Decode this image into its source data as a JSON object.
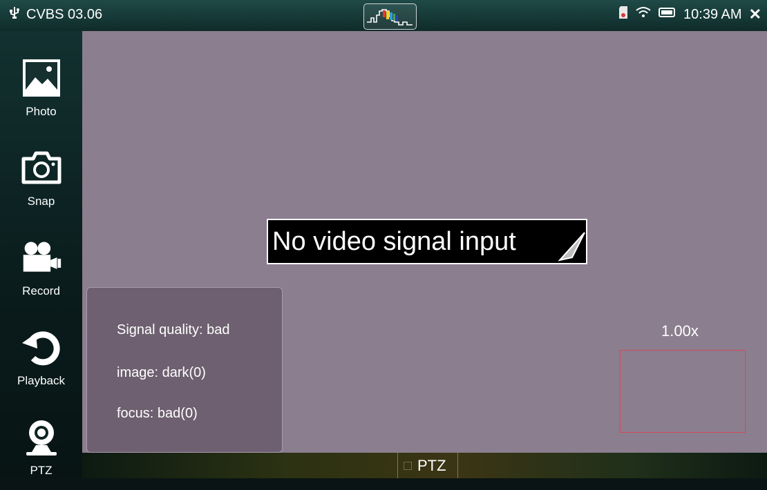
{
  "status": {
    "channel": "CVBS 03.06",
    "time": "10:39 AM",
    "close_glyph": "✕",
    "signal_icon": "usb-icon",
    "center_icon": "waveform-icon",
    "sd_icon": "sd-card-icon",
    "wifi_icon": "wifi-icon",
    "battery_icon": "battery-icon"
  },
  "sidebar": {
    "items": [
      {
        "label": "Photo",
        "icon": "photo-icon"
      },
      {
        "label": "Snap",
        "icon": "camera-icon"
      },
      {
        "label": "Record",
        "icon": "video-camera-icon"
      },
      {
        "label": "Playback",
        "icon": "playback-icon"
      },
      {
        "label": "PTZ",
        "icon": "webcam-icon"
      }
    ]
  },
  "video": {
    "message": "No video signal input",
    "quality": {
      "signal": "Signal quality: bad",
      "image": "image: dark(0)",
      "focus": "focus: bad(0)"
    },
    "zoom": "1.00x"
  },
  "bottom": {
    "ptz_label": "PTZ"
  },
  "colors": {
    "video_bg": "#8b7e8f",
    "panel_bg": "#6e6070",
    "zoom_border": "#d14b56",
    "statusbar": "#1f4a47"
  }
}
